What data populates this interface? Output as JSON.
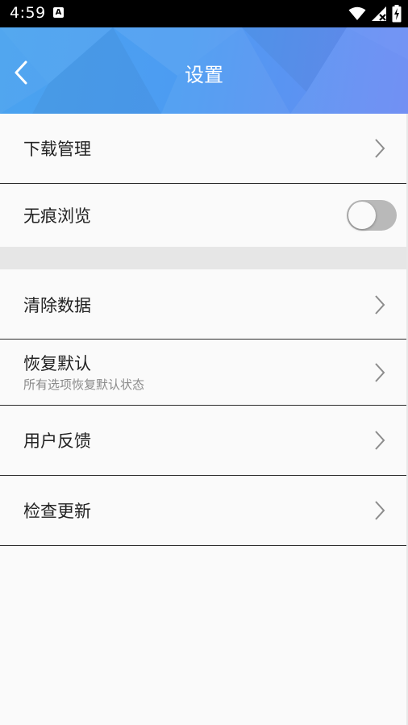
{
  "status_bar": {
    "time": "4:59",
    "notification_icon_letter": "A",
    "icons": [
      "wifi-icon",
      "signal-icon",
      "battery-icon"
    ]
  },
  "header": {
    "title": "设置",
    "back_icon": "chevron-left-icon",
    "gradient_start": "#4aa3ef",
    "gradient_end": "#6a8af3"
  },
  "settings": {
    "download_manager": {
      "label": "下载管理"
    },
    "incognito": {
      "label": "无痕浏览",
      "toggle_on": false
    },
    "clear_data": {
      "label": "清除数据"
    },
    "restore_defaults": {
      "label": "恢复默认",
      "subtitle": "所有选项恢复默认状态"
    },
    "feedback": {
      "label": "用户反馈"
    },
    "check_update": {
      "label": "检查更新"
    }
  },
  "colors": {
    "text_primary": "#222222",
    "text_secondary": "#8a8a8a",
    "divider": "#2c2c2c",
    "section_gap": "#e6e6e6",
    "toggle_off": "#b9b9b9",
    "chevron": "#8c8c8c"
  }
}
